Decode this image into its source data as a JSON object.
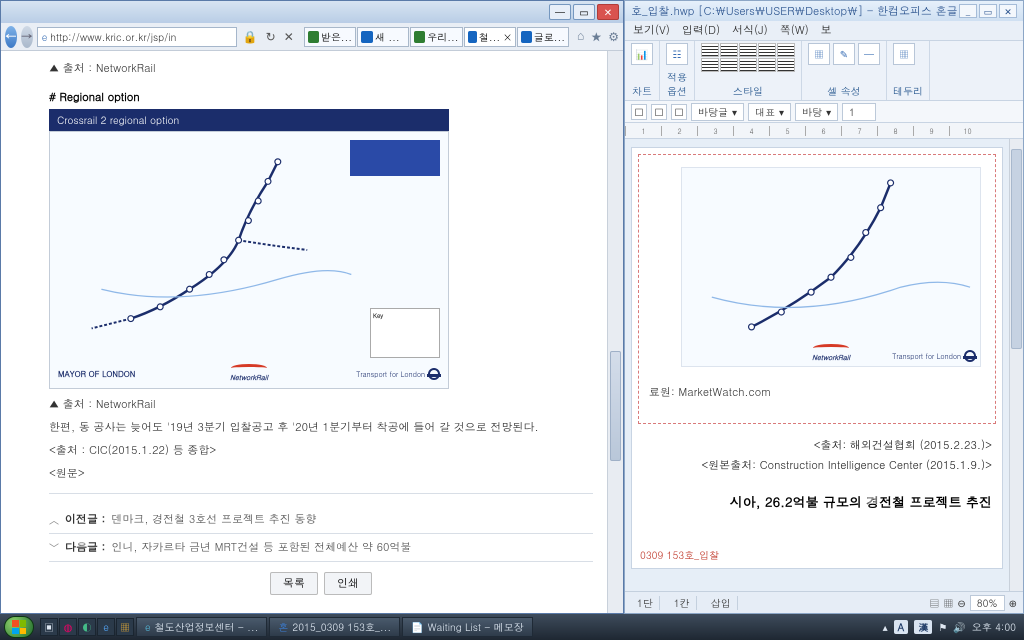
{
  "ie": {
    "url": "http://www.kric.or.kr/jsp/in",
    "tabs": [
      {
        "label": "받은..."
      },
      {
        "label": "새 ..."
      },
      {
        "label": "우리..."
      },
      {
        "label": "철... ×"
      },
      {
        "label": "글로..."
      }
    ],
    "src1": "▲ 출처 : NetworkRail",
    "section": "# Regional option",
    "mapTitle": "Crossrail 2 regional option",
    "legend": "Key",
    "mayor": "MAYOR OF LONDON",
    "nr": "NetworkRail",
    "tfl": "Transport for London",
    "src2": "▲ 출처 : NetworkRail",
    "para": "한편, 동 공사는 늦어도 '19년 3분기 입찰공고 후 '20년 1분기부터 착공에 들어 갈 것으로 전망된다.",
    "cite": "<출처 : CIC(2015.1.22) 등 종합>",
    "orig": "<원문>",
    "prev_l": "이전글 :",
    "prev_t": "덴마크, 경전철 3호선 프로젝트 추진 동향",
    "next_l": "다음글 :",
    "next_t": "인니, 자카르타 금년 MRT건설 등 포함된 전체예산 약 60억불",
    "btn_list": "목록",
    "btn_print": "인쇄"
  },
  "hw": {
    "title": "호_입찰.hwp [C:\\Users\\USER\\Desktop\\] - 한컴오피스 혼글",
    "menu": [
      "보기(V)",
      "입력(D)",
      "서식(J)",
      "쪽(W)",
      "보"
    ],
    "rib": {
      "chart": "차트",
      "apply": "적용\n옵션",
      "style": "스타일",
      "cell": "셀 속성",
      "border": "테두리"
    },
    "fmt": {
      "style1": "바탕글",
      "style2": "대표",
      "style3": "바탕",
      "size": "1"
    },
    "src": "료원: MarketWatch.com",
    "line1": "<출처: 해외건설협회 (2015.2.23.)>",
    "line2": "<원본출처: Construction Intelligence Center (2015.1.9.)>",
    "headline": "시아, 26.2억불 규모의 경전철 프로젝트 추진",
    "redname": "0309 153호_입찰",
    "status": {
      "c1": "1단",
      "c2": "1칸",
      "c3": "삽입",
      "zoom": "80%"
    }
  },
  "task": {
    "items": [
      "철도산업정보센터 - ...",
      "2015_0309 153호_...",
      "Waiting List - 메모장"
    ],
    "ime1": "A",
    "ime2": "漢",
    "clock": "오후 4:00"
  }
}
